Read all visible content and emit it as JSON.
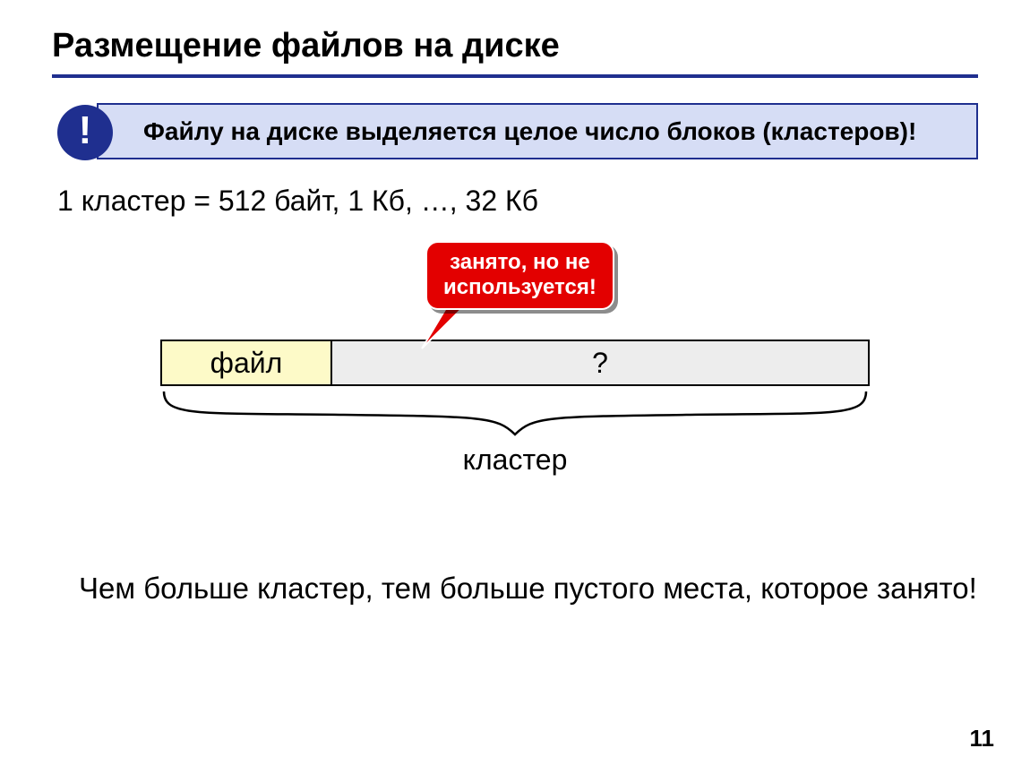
{
  "title": "Размещение файлов на диске",
  "bang": "!",
  "callout": "Файлу на диске выделяется целое число блоков (кластеров)!",
  "cluster_size_line": "1 кластер = 512 байт, 1 Кб, …, 32 Кб",
  "bubble_line1": "занято, но не",
  "bubble_line2": "используется!",
  "bar_file_label": "файл",
  "bar_rest_label": "?",
  "brace_label": "кластер",
  "conclusion": "Чем больше кластер, тем больше пустого места, которое занято!",
  "page_number": "11"
}
